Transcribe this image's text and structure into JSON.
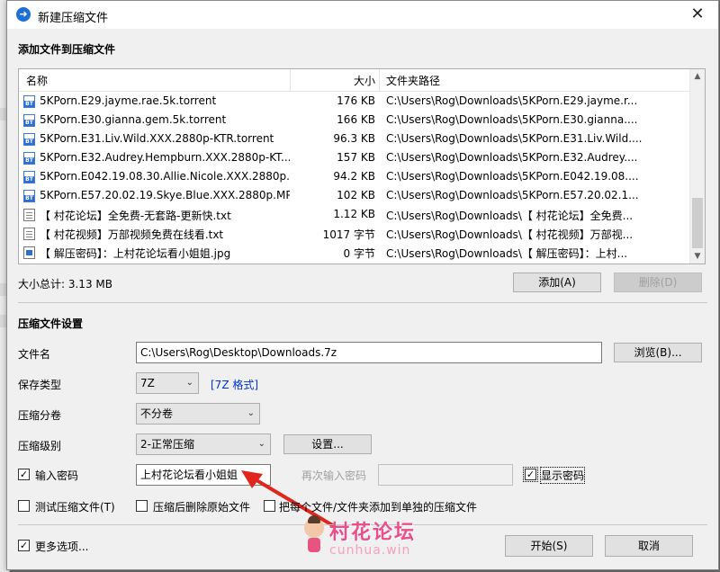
{
  "window": {
    "title": "新建压缩文件",
    "close_glyph": "✕",
    "app_icon_glyph": "➜"
  },
  "files_section": {
    "heading": "添加文件到压缩文件",
    "columns": {
      "name": "名称",
      "size": "大小",
      "path": "文件夹路径"
    },
    "files": [
      {
        "icon": "bt-torrent-icon",
        "name": "5KPorn.E29.jayme.rae.5k.torrent",
        "size": "176 KB",
        "path": "C:\\Users\\Rog\\Downloads\\5KPorn.E29.jayme.r..."
      },
      {
        "icon": "bt-torrent-icon",
        "name": "5KPorn.E30.gianna.gem.5k.torrent",
        "size": "166 KB",
        "path": "C:\\Users\\Rog\\Downloads\\5KPorn.E30.gianna...."
      },
      {
        "icon": "bt-torrent-icon",
        "name": "5KPorn.E31.Liv.Wild.XXX.2880p-KTR.torrent",
        "size": "96.3 KB",
        "path": "C:\\Users\\Rog\\Downloads\\5KPorn.E31.Liv.Wild...."
      },
      {
        "icon": "bt-torrent-icon",
        "name": "5KPorn.E32.Audrey.Hempburn.XXX.2880p-KT...",
        "size": "157 KB",
        "path": "C:\\Users\\Rog\\Downloads\\5KPorn.E32.Audrey...."
      },
      {
        "icon": "bt-torrent-icon",
        "name": "5KPorn.E042.19.08.30.Allie.Nicole.XXX.2880p....",
        "size": "94.2 KB",
        "path": "C:\\Users\\Rog\\Downloads\\5KPorn.E042.19.08...."
      },
      {
        "icon": "bt-torrent-icon",
        "name": "5KPorn.E57.20.02.19.Skye.Blue.XXX.2880p.MP...",
        "size": "102 KB",
        "path": "C:\\Users\\Rog\\Downloads\\5KPorn.E57.20.02.1..."
      },
      {
        "icon": "text-file-icon",
        "name": "【 村花论坛】全免费-无套路-更新快.txt",
        "size": "1.12 KB",
        "path": "C:\\Users\\Rog\\Downloads\\【 村花论坛】全免费..."
      },
      {
        "icon": "text-file-icon",
        "name": "【 村花视频】万部视频免费在线看.txt",
        "size": "1017 字节",
        "path": "C:\\Users\\Rog\\Downloads\\【 村花视频】万部视..."
      },
      {
        "icon": "image-file-icon",
        "name": "【 解压密码】：上村花论坛看小姐姐.jpg",
        "size": "0 字节",
        "path": "C:\\Users\\Rog\\Downloads\\【 解压密码】：上村..."
      }
    ],
    "total_label": "大小总计: 3.13 MB",
    "add_button": "添加(A)",
    "remove_button": "删除(D)"
  },
  "settings": {
    "heading": "压缩文件设置",
    "filename_label": "文件名",
    "filename_value": "C:\\Users\\Rog\\Desktop\\Downloads.7z",
    "browse_button": "浏览(B)...",
    "save_type_label": "保存类型",
    "save_type_value": "7Z",
    "format_link": "[7Z 格式]",
    "split_label": "压缩分卷",
    "split_value": "不分卷",
    "level_label": "压缩级别",
    "level_value": "2-正常压缩",
    "level_settings_button": "设置...",
    "password_checkbox": "输入密码",
    "password_checked": true,
    "password_value": "上村花论坛看小姐姐",
    "reenter_label": "再次输入密码",
    "reenter_value": "",
    "show_password_checkbox": "显示密码",
    "show_password_checked": true,
    "test_checkbox": "测试压缩文件(T)",
    "delete_after_checkbox": "压缩后删除原始文件",
    "separate_checkbox": "把每个文件/文件夹添加到单独的压缩文件",
    "more_options_checkbox": "更多选项...",
    "more_options_checked": true,
    "start_button": "开始(S)",
    "cancel_button": "取消"
  },
  "watermark": {
    "text": "村花论坛",
    "url": "cunhua.win"
  },
  "colors": {
    "accent_blue": "#0033cc",
    "arrow_red": "#e0261c",
    "watermark_pink": "#e94f8a"
  }
}
